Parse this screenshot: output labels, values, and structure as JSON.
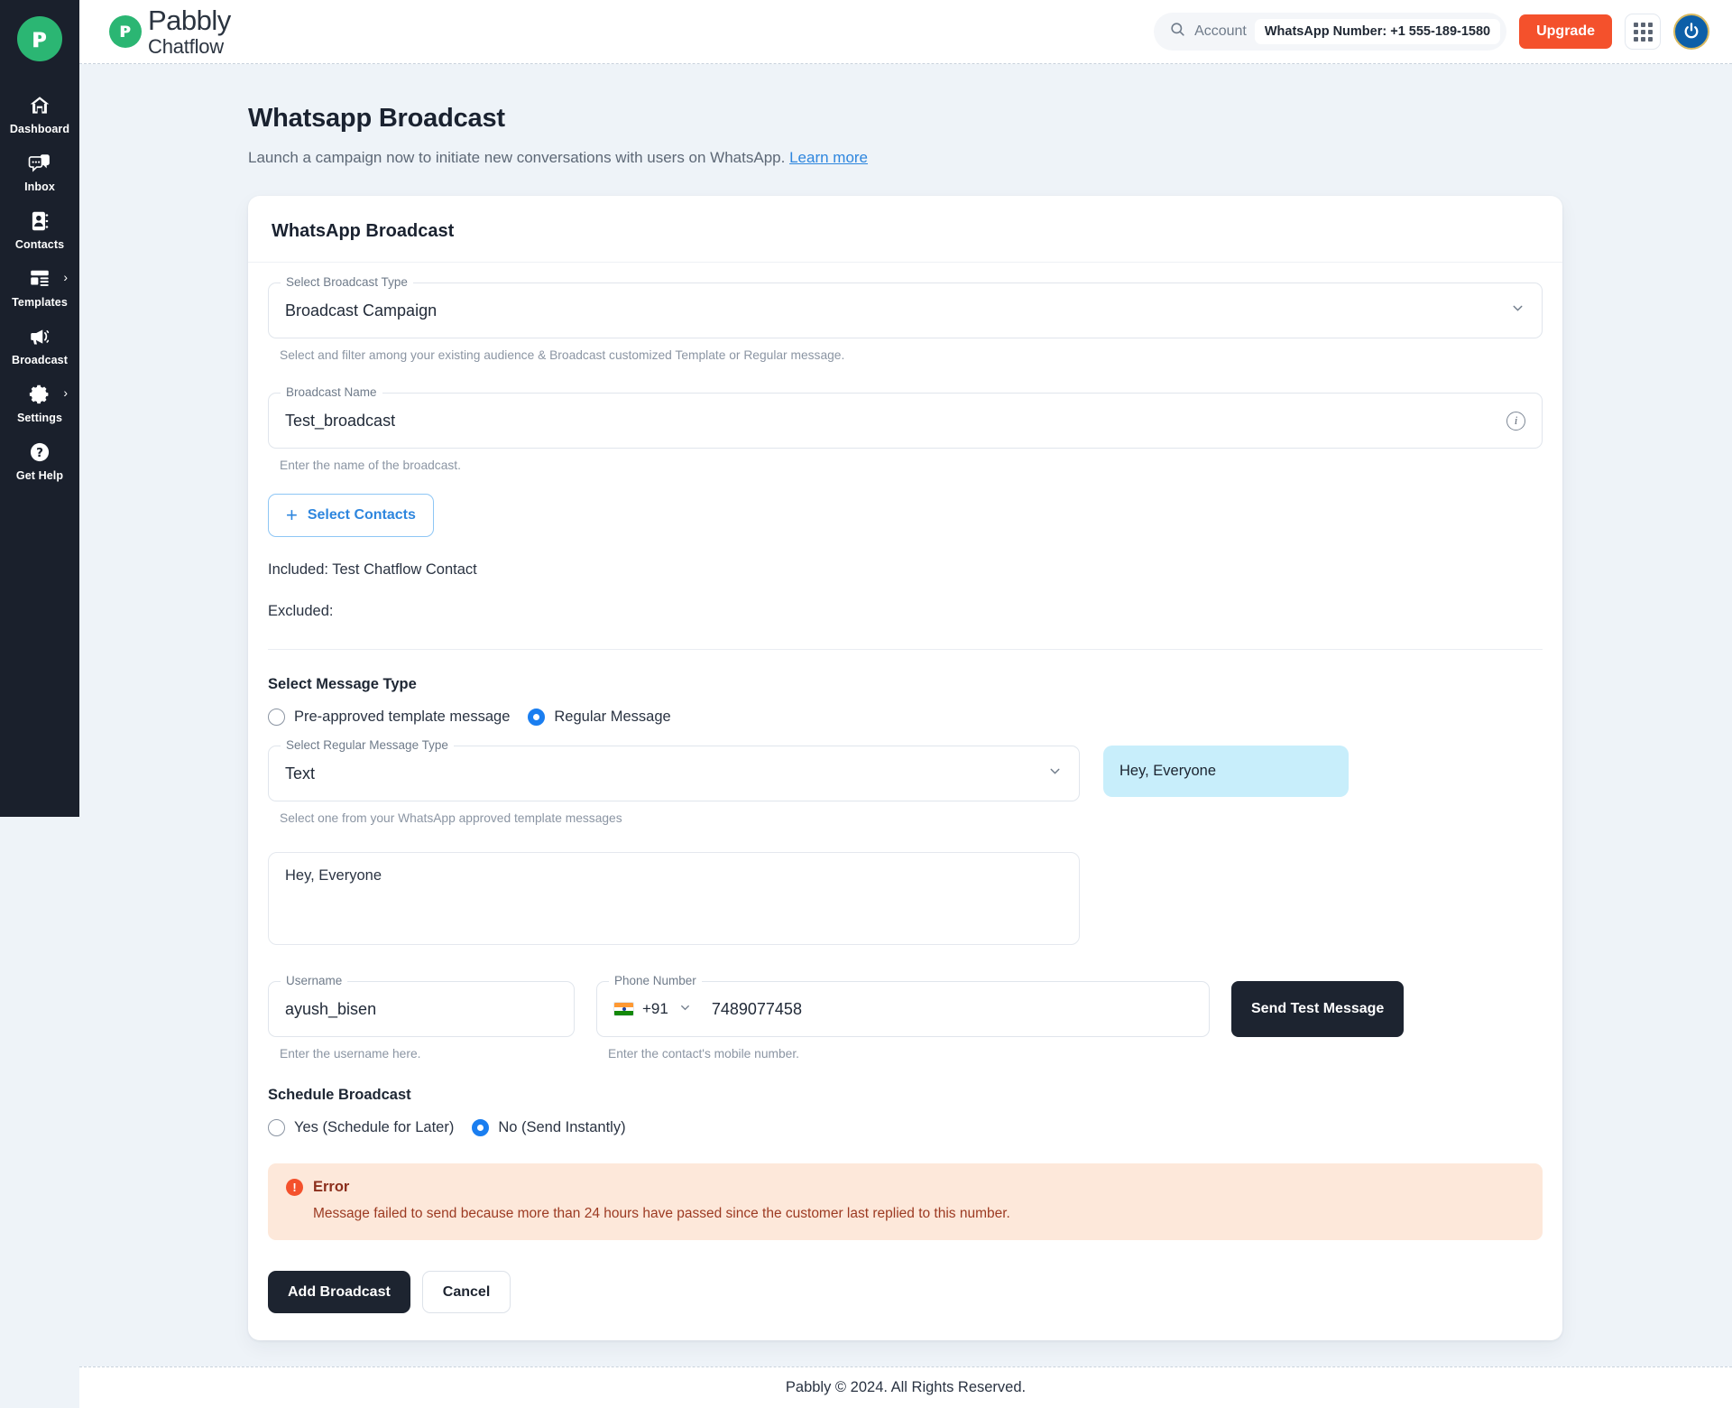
{
  "sidebar": {
    "logo_letter": "ᴘ",
    "items": [
      {
        "label": "Dashboard",
        "icon": "home-icon",
        "chevron": false
      },
      {
        "label": "Inbox",
        "icon": "chat-bubble-icon",
        "chevron": false
      },
      {
        "label": "Contacts",
        "icon": "contact-book-icon",
        "chevron": false
      },
      {
        "label": "Templates",
        "icon": "template-layout-icon",
        "chevron": true
      },
      {
        "label": "Broadcast",
        "icon": "megaphone-icon",
        "chevron": false
      },
      {
        "label": "Settings",
        "icon": "gear-icon",
        "chevron": true
      },
      {
        "label": "Get Help",
        "icon": "question-mark-icon",
        "chevron": false
      }
    ]
  },
  "topbar": {
    "brand_letter": "ᴘ",
    "brand_line1": "Pabbly",
    "brand_line2": "Chatflow",
    "search_label": "Account",
    "whatsapp_chip": "WhatsApp Number: +1 555-189-1580",
    "upgrade_label": "Upgrade",
    "grid_icon": "apps-grid-icon",
    "avatar_icon": "power-user-icon"
  },
  "page": {
    "title": "Whatsapp Broadcast",
    "subtitle": "Launch a campaign now to initiate new conversations with users on WhatsApp.",
    "learn_more": "Learn more"
  },
  "card": {
    "title": "WhatsApp Broadcast",
    "broadcast_type": {
      "legend": "Select Broadcast Type",
      "value": "Broadcast Campaign",
      "help": "Select and filter among your existing audience & Broadcast customized Template or Regular message."
    },
    "broadcast_name": {
      "legend": "Broadcast Name",
      "value": "Test_broadcast",
      "placeholder": "Broadcast Name",
      "help": "Enter the name of the broadcast.",
      "info_icon": "info-circle-icon"
    },
    "select_contacts_label": "Select Contacts",
    "included_line": "Included: Test Chatflow Contact",
    "excluded_line": "Excluded:",
    "message_type": {
      "label": "Select Message Type",
      "options": [
        {
          "label": "Pre-approved template message",
          "selected": false
        },
        {
          "label": "Regular Message",
          "selected": true
        }
      ]
    },
    "regular_message_type": {
      "legend": "Select Regular Message Type",
      "value": "Text",
      "help": "Select one from your WhatsApp approved template messages"
    },
    "preview_bubble": "Hey, Everyone",
    "message_body": "Hey, Everyone",
    "username": {
      "legend": "Username",
      "value": "ayush_bisen",
      "placeholder": "Username",
      "help": "Enter the username here."
    },
    "phone": {
      "legend": "Phone Number",
      "country_code": "+91",
      "flag": "india-flag-icon",
      "value": "7489077458",
      "placeholder": "Phone Number",
      "help": "Enter the contact's mobile number."
    },
    "send_test_label": "Send Test Message",
    "schedule": {
      "label": "Schedule Broadcast",
      "options": [
        {
          "label": "Yes (Schedule for Later)",
          "selected": false
        },
        {
          "label": "No (Send Instantly)",
          "selected": true
        }
      ]
    },
    "error": {
      "icon": "error-exclamation-icon",
      "title": "Error",
      "message": "Message failed to send because more than 24 hours have passed since the customer last replied to this number."
    },
    "add_broadcast_label": "Add Broadcast",
    "cancel_label": "Cancel"
  },
  "footer": {
    "text": "Pabbly © 2024. All Rights Reserved."
  },
  "colors": {
    "accent_green": "#2bb673",
    "accent_orange": "#f4512c",
    "accent_blue": "#1a7ef0",
    "link_blue": "#2e86de",
    "sidebar_bg": "#1a202c",
    "page_bg": "#eef3f8",
    "bubble_bg": "#c8eefb",
    "error_bg": "#fde8da",
    "error_text": "#9c3a22"
  }
}
